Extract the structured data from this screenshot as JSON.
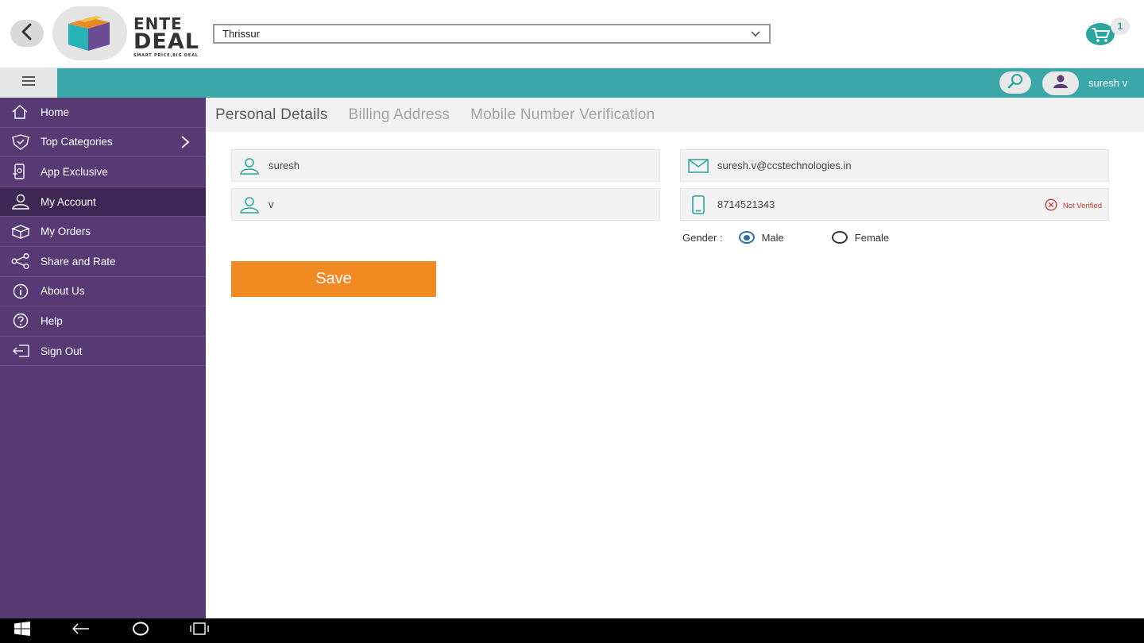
{
  "header": {
    "logo": {
      "line1": "ENTE",
      "line2": "DEAL",
      "tagline": "SMART PRICE,BIG DEAL"
    },
    "location_select": {
      "value": "Thrissur"
    },
    "cart": {
      "count": "1"
    }
  },
  "topbar": {
    "user_name": "suresh v"
  },
  "sidebar": {
    "items": [
      {
        "label": "Home",
        "icon": "home-icon"
      },
      {
        "label": "Top Categories",
        "icon": "badge-icon"
      },
      {
        "label": "App Exclusive",
        "icon": "exclusive-icon"
      },
      {
        "label": "My Account",
        "icon": "user-icon"
      },
      {
        "label": "My Orders",
        "icon": "box-icon"
      },
      {
        "label": "Share and Rate",
        "icon": "share-icon"
      },
      {
        "label": "About Us",
        "icon": "info-icon"
      },
      {
        "label": "Help",
        "icon": "help-icon"
      },
      {
        "label": "Sign Out",
        "icon": "sign-out-icon"
      }
    ],
    "active_index": 3
  },
  "tabs": [
    {
      "label": "Personal Details",
      "active": true
    },
    {
      "label": "Billing Address",
      "active": false
    },
    {
      "label": "Mobile Number Verification",
      "active": false
    }
  ],
  "form": {
    "first_name": "suresh",
    "last_name": "v",
    "email": "suresh.v@ccstechnologies.in",
    "mobile": "8714521343",
    "mobile_status": "Not Verified",
    "gender_label": "Gender :",
    "gender_options": [
      "Male",
      "Female"
    ],
    "gender_selected": "Male",
    "save_label": "Save"
  },
  "colors": {
    "teal": "#3aa7a9",
    "sidebar": "#573a74",
    "sidebar_active": "#3e2755",
    "save": "#f28a24",
    "error": "#c0392b"
  }
}
